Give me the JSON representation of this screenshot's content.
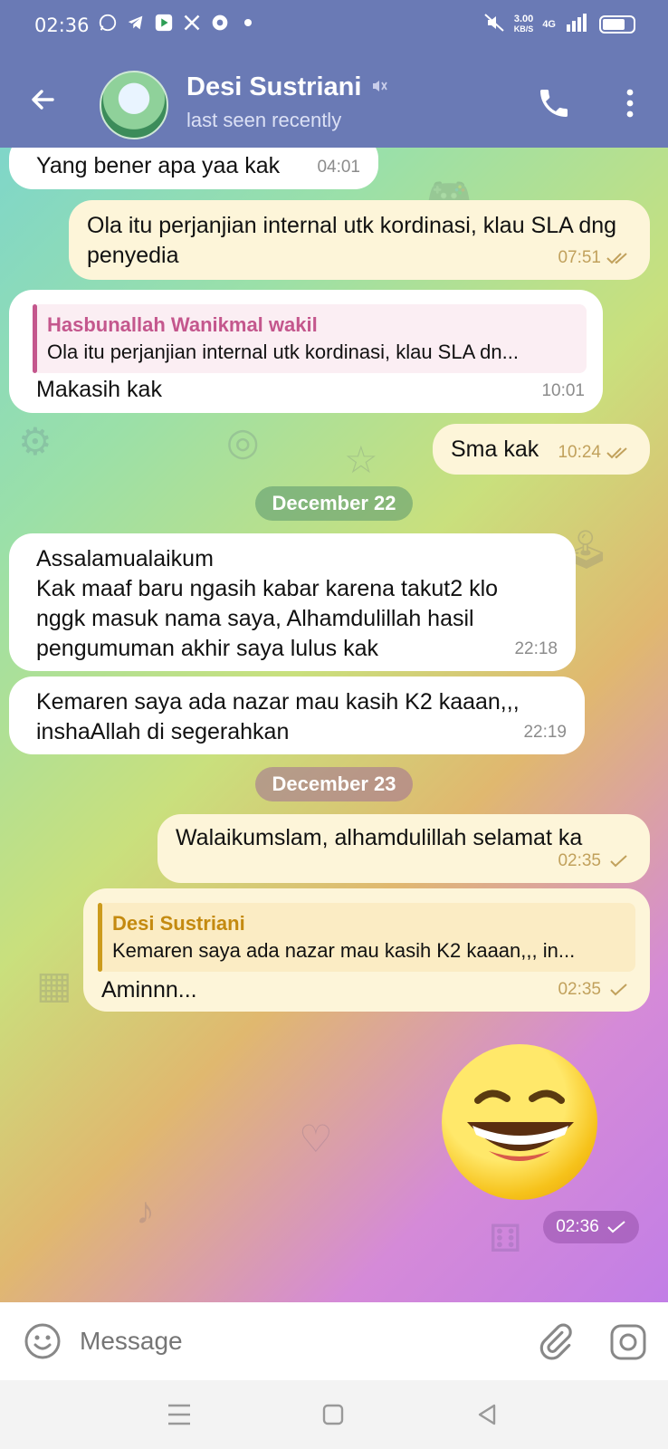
{
  "status_bar": {
    "time": "02:36",
    "speed_value": "3.00",
    "speed_unit": "KB/S",
    "network": "4G"
  },
  "header": {
    "contact_name": "Desi Sustriani",
    "last_seen": "last seen recently"
  },
  "messages": [
    {
      "direction": "in",
      "text": "Yang bener apa yaa kak",
      "time": "04:01"
    },
    {
      "direction": "out",
      "text": "Ola itu perjanjian internal utk kordinasi, klau SLA dng penyedia",
      "time": "07:51",
      "status": "read"
    },
    {
      "direction": "in",
      "reply_author": "Hasbunallah Wanikmal wakil",
      "reply_text": "Ola itu perjanjian internal utk kordinasi, klau SLA dn...",
      "text": "Makasih kak",
      "time": "10:01"
    },
    {
      "direction": "out",
      "text": "Sma kak",
      "time": "10:24",
      "status": "read"
    },
    {
      "direction": "in",
      "text": "Assalamualaikum\nKak maaf baru ngasih kabar karena takut2 klo nggk masuk nama saya,  Alhamdulillah hasil pengumuman akhir saya lulus kak",
      "time": "22:18"
    },
    {
      "direction": "in",
      "text": "Kemaren saya ada nazar mau kasih K2 kaaan,,, inshaAllah di segerahkan",
      "time": "22:19"
    },
    {
      "direction": "out",
      "text": "Walaikumslam, alhamdulillah selamat ka",
      "time": "02:35",
      "status": "sent"
    },
    {
      "direction": "out",
      "reply_author": "Desi Sustriani",
      "reply_text": "Kemaren saya ada nazar mau kasih K2 kaaan,,, in...",
      "text": "Aminnn...",
      "time": "02:35",
      "status": "sent"
    },
    {
      "direction": "out",
      "type": "sticker",
      "sticker": "grinning-squinting-face",
      "time": "02:36",
      "status": "sent"
    }
  ],
  "date_separators": [
    "December 22",
    "December 23"
  ],
  "input": {
    "placeholder": "Message"
  },
  "colors": {
    "header_bg": "#6a7ab5",
    "incoming_bubble": "#ffffff",
    "outgoing_bubble": "#fdf5d9",
    "reply_in_accent": "#c4578d",
    "reply_out_accent": "#c48a10"
  },
  "icons": [
    "back-arrow-icon",
    "muted-icon",
    "phone-icon",
    "more-vert-icon",
    "emoji-icon",
    "attach-icon",
    "camera-icon",
    "double-check-icon",
    "check-icon"
  ]
}
